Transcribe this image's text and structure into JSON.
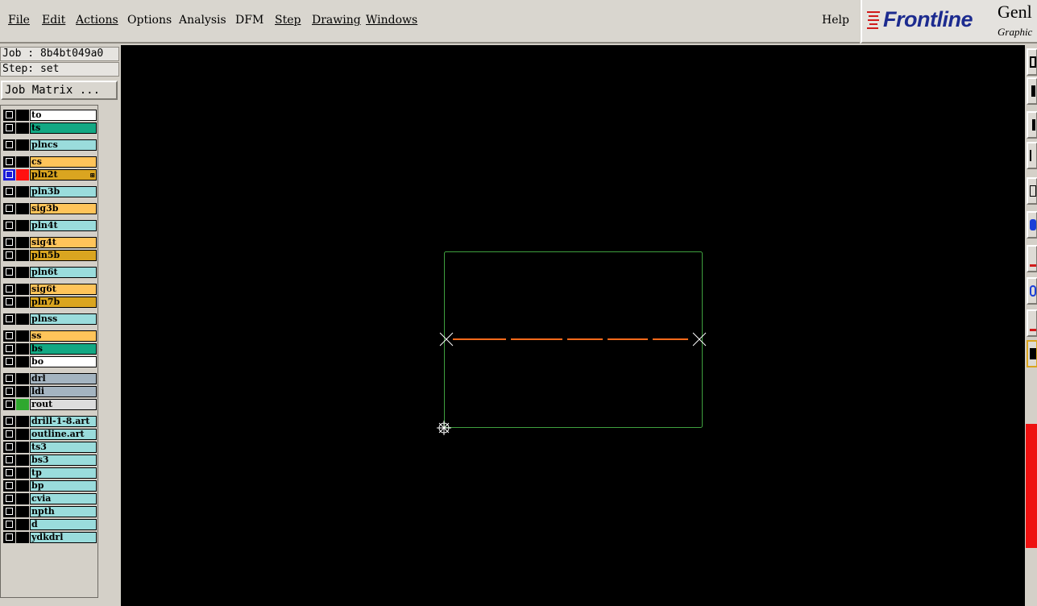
{
  "menu": {
    "file": "File",
    "edit": "Edit",
    "actions": "Actions",
    "options": "Options",
    "analysis": "Analysis",
    "dfm": "DFM",
    "step": "Step",
    "drawing": "Drawing",
    "windows": "Windows",
    "help": "Help"
  },
  "logo": {
    "brand": "Frontline",
    "product": "Genl",
    "subtitle": "Graphic"
  },
  "job": {
    "job_line": "Job : 8b4bt049a0",
    "step_line": "Step: set",
    "matrix_button": "Job Matrix ..."
  },
  "layers": [
    {
      "name": "to",
      "color": "#ffffff"
    },
    {
      "name": "ts",
      "color": "#13a883"
    },
    {
      "name": "plncs",
      "color": "#9adcdc"
    },
    {
      "name": "cs",
      "color": "#ffc45a"
    },
    {
      "name": "pln2t",
      "color": "#daa520",
      "selected": true,
      "swatch": "#ff1010",
      "mark": "⊞"
    },
    {
      "name": "pln3b",
      "color": "#9adcdc"
    },
    {
      "name": "sig3b",
      "color": "#ffc45a"
    },
    {
      "name": "pln4t",
      "color": "#9adcdc"
    },
    {
      "name": "sig4t",
      "color": "#ffc45a"
    },
    {
      "name": "pln5b",
      "color": "#daa520"
    },
    {
      "name": "pln6t",
      "color": "#9adcdc"
    },
    {
      "name": "sig6t",
      "color": "#ffc45a"
    },
    {
      "name": "pln7b",
      "color": "#daa520"
    },
    {
      "name": "plnss",
      "color": "#9adcdc"
    },
    {
      "name": "ss",
      "color": "#ffc45a"
    },
    {
      "name": "bs",
      "color": "#13a883"
    },
    {
      "name": "bo",
      "color": "#ffffff"
    },
    {
      "name": "drl",
      "color": "#a4b4c0"
    },
    {
      "name": "ldi",
      "color": "#a4b4c0"
    },
    {
      "name": "rout",
      "color": "#dcdcdc",
      "swatch": "#2fa82f"
    },
    {
      "name": "drill-1-8.art",
      "color": "#9adcdc"
    },
    {
      "name": "outline.art",
      "color": "#9adcdc"
    },
    {
      "name": "ts3",
      "color": "#9adcdc"
    },
    {
      "name": "bs3",
      "color": "#9adcdc"
    },
    {
      "name": "tp",
      "color": "#9adcdc"
    },
    {
      "name": "bp",
      "color": "#9adcdc"
    },
    {
      "name": "cvia",
      "color": "#9adcdc"
    },
    {
      "name": "npth",
      "color": "#9adcdc"
    },
    {
      "name": "d",
      "color": "#9adcdc"
    },
    {
      "name": "ydkdrl",
      "color": "#9adcdc"
    }
  ],
  "canvas": {
    "background": "#000000",
    "profile_color": "#3fa03f",
    "line_color": "#ff6a1a",
    "marker_color": "#ffffff"
  },
  "colors": {
    "menubar": "#d9d6cf",
    "panel": "#d4d0c8",
    "brand": "#1c2b8f",
    "brand_red": "#d11a1a",
    "status_red": "#ee1111"
  }
}
